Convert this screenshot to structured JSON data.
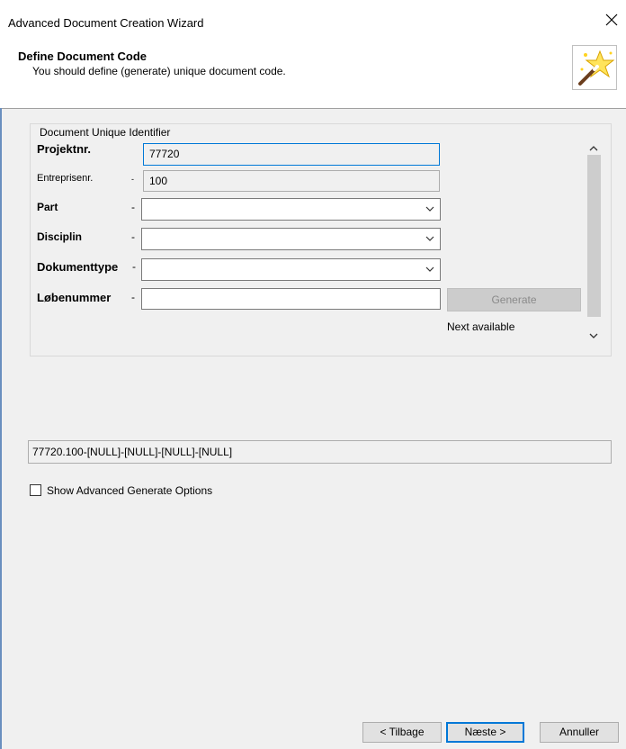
{
  "window": {
    "title": "Advanced Document Creation Wizard"
  },
  "header": {
    "title": "Define Document Code",
    "subtitle": "You should define (generate) unique document code."
  },
  "group": {
    "legend": "Document Unique Identifier",
    "fields": {
      "projektnr": {
        "label": "Projektnr.",
        "value": "77720"
      },
      "entreprisenr": {
        "label": "Entreprisenr.",
        "dash": "-",
        "value": "100"
      },
      "part": {
        "label": "Part",
        "dash": "-",
        "value": ""
      },
      "disciplin": {
        "label": "Disciplin",
        "dash": "-",
        "value": ""
      },
      "dokumenttype": {
        "label": "Dokumenttype",
        "dash": "-",
        "value": ""
      },
      "lobenummer": {
        "label": "Løbenummer",
        "dash": "-",
        "value": ""
      }
    },
    "generate_label": "Generate",
    "next_available": "Next available"
  },
  "preview": {
    "code": "77720.100-[NULL]-[NULL]-[NULL]-[NULL]"
  },
  "options": {
    "show_advanced_label": "Show Advanced Generate Options",
    "show_advanced_checked": false
  },
  "buttons": {
    "back": "< Tilbage",
    "next": "Næste >",
    "cancel": "Annuller"
  },
  "colors": {
    "focus": "#0078d7",
    "header_bg": "#ffffff",
    "dialog_bg": "#f0f0f0"
  },
  "icons": {
    "close": "close-icon",
    "wizard": "magic-wand-star-icon",
    "dropdown": "chevron-down-icon"
  }
}
